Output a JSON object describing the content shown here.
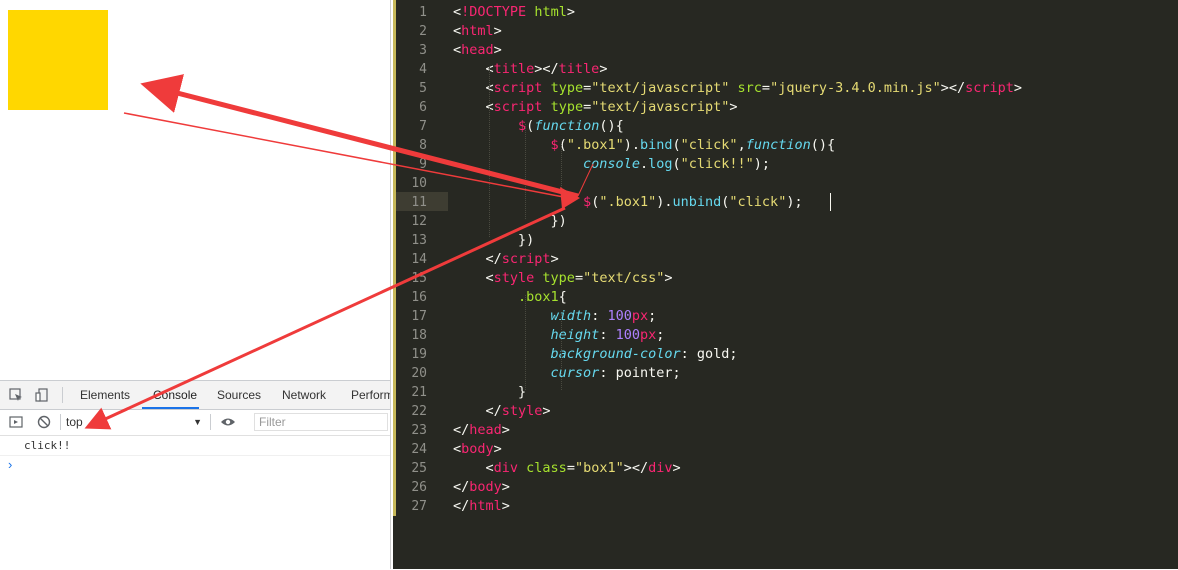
{
  "devtools": {
    "tabs": [
      {
        "label": "Elements"
      },
      {
        "label": "Console"
      },
      {
        "label": "Sources"
      },
      {
        "label": "Network"
      },
      {
        "label": "Perform"
      }
    ],
    "active_tab": "Console",
    "context": "top",
    "filter_placeholder": "Filter",
    "console_messages": [
      "click!!"
    ],
    "prompt_symbol": "›"
  },
  "editor": {
    "line_numbers": [
      "1",
      "2",
      "3",
      "4",
      "5",
      "6",
      "7",
      "8",
      "9",
      "10",
      "11",
      "12",
      "13",
      "14",
      "15",
      "16",
      "17",
      "18",
      "19",
      "20",
      "21",
      "22",
      "23",
      "24",
      "25",
      "26",
      "27"
    ],
    "active_line": 11,
    "lines": [
      [
        [
          "tk-plain",
          "<"
        ],
        [
          "tk-tag",
          "!DOCTYPE"
        ],
        [
          "tk-plain",
          " "
        ],
        [
          "tk-attr",
          "html"
        ],
        [
          "tk-plain",
          ">"
        ]
      ],
      [
        [
          "tk-plain",
          "<"
        ],
        [
          "tk-tag",
          "html"
        ],
        [
          "tk-plain",
          ">"
        ]
      ],
      [
        [
          "tk-plain",
          "<"
        ],
        [
          "tk-tag",
          "head"
        ],
        [
          "tk-plain",
          ">"
        ]
      ],
      [
        [
          "tk-plain",
          "    <"
        ],
        [
          "tk-tag",
          "title"
        ],
        [
          "tk-plain",
          "></"
        ],
        [
          "tk-tag",
          "title"
        ],
        [
          "tk-plain",
          ">"
        ]
      ],
      [
        [
          "tk-plain",
          "    <"
        ],
        [
          "tk-tag",
          "script"
        ],
        [
          "tk-plain",
          " "
        ],
        [
          "tk-attr",
          "type"
        ],
        [
          "tk-plain",
          "="
        ],
        [
          "tk-str",
          "\"text/javascript\""
        ],
        [
          "tk-plain",
          " "
        ],
        [
          "tk-attr",
          "src"
        ],
        [
          "tk-plain",
          "="
        ],
        [
          "tk-str",
          "\"jquery-3.4.0.min.js\""
        ],
        [
          "tk-plain",
          "></"
        ],
        [
          "tk-tag",
          "script"
        ],
        [
          "tk-plain",
          ">"
        ]
      ],
      [
        [
          "tk-plain",
          "    <"
        ],
        [
          "tk-tag",
          "script"
        ],
        [
          "tk-plain",
          " "
        ],
        [
          "tk-attr",
          "type"
        ],
        [
          "tk-plain",
          "="
        ],
        [
          "tk-str",
          "\"text/javascript\""
        ],
        [
          "tk-plain",
          ">"
        ]
      ],
      [
        [
          "tk-plain",
          "        "
        ],
        [
          "tk-dollar",
          "$"
        ],
        [
          "tk-plain",
          "("
        ],
        [
          "tk-kw",
          "function"
        ],
        [
          "tk-plain",
          "(){"
        ]
      ],
      [
        [
          "tk-plain",
          "            "
        ],
        [
          "tk-dollar",
          "$"
        ],
        [
          "tk-plain",
          "("
        ],
        [
          "tk-str",
          "\".box1\""
        ],
        [
          "tk-plain",
          ")."
        ],
        [
          "tk-fn",
          "bind"
        ],
        [
          "tk-plain",
          "("
        ],
        [
          "tk-str",
          "\"click\""
        ],
        [
          "tk-plain",
          ","
        ],
        [
          "tk-kw",
          "function"
        ],
        [
          "tk-plain",
          "(){"
        ]
      ],
      [
        [
          "tk-plain",
          "                "
        ],
        [
          "tk-prop",
          "console"
        ],
        [
          "tk-plain",
          "."
        ],
        [
          "tk-fn",
          "log"
        ],
        [
          "tk-plain",
          "("
        ],
        [
          "tk-str",
          "\"click!!\""
        ],
        [
          "tk-plain",
          ");"
        ]
      ],
      [
        [
          "tk-plain",
          ""
        ]
      ],
      [
        [
          "tk-plain",
          "                "
        ],
        [
          "tk-dollar",
          "$"
        ],
        [
          "tk-plain",
          "("
        ],
        [
          "tk-str",
          "\".box1\""
        ],
        [
          "tk-plain",
          ")."
        ],
        [
          "tk-fn",
          "unbind"
        ],
        [
          "tk-plain",
          "("
        ],
        [
          "tk-str",
          "\"click\""
        ],
        [
          "tk-plain",
          ");"
        ]
      ],
      [
        [
          "tk-plain",
          "            })"
        ]
      ],
      [
        [
          "tk-plain",
          "        })"
        ]
      ],
      [
        [
          "tk-plain",
          "    </"
        ],
        [
          "tk-tag",
          "script"
        ],
        [
          "tk-plain",
          ">"
        ]
      ],
      [
        [
          "tk-plain",
          "    <"
        ],
        [
          "tk-tag",
          "style"
        ],
        [
          "tk-plain",
          " "
        ],
        [
          "tk-attr",
          "type"
        ],
        [
          "tk-plain",
          "="
        ],
        [
          "tk-str",
          "\"text/css\""
        ],
        [
          "tk-plain",
          ">"
        ]
      ],
      [
        [
          "tk-plain",
          "        "
        ],
        [
          "tk-sel",
          ".box1"
        ],
        [
          "tk-plain",
          "{"
        ]
      ],
      [
        [
          "tk-plain",
          "            "
        ],
        [
          "tk-prop",
          "width"
        ],
        [
          "tk-plain",
          ": "
        ],
        [
          "tk-num",
          "100"
        ],
        [
          "tk-unit",
          "px"
        ],
        [
          "tk-plain",
          ";"
        ]
      ],
      [
        [
          "tk-plain",
          "            "
        ],
        [
          "tk-prop",
          "height"
        ],
        [
          "tk-plain",
          ": "
        ],
        [
          "tk-num",
          "100"
        ],
        [
          "tk-unit",
          "px"
        ],
        [
          "tk-plain",
          ";"
        ]
      ],
      [
        [
          "tk-plain",
          "            "
        ],
        [
          "tk-prop",
          "background-color"
        ],
        [
          "tk-plain",
          ": gold;"
        ]
      ],
      [
        [
          "tk-plain",
          "            "
        ],
        [
          "tk-prop",
          "cursor"
        ],
        [
          "tk-plain",
          ": pointer;"
        ]
      ],
      [
        [
          "tk-plain",
          "        }"
        ]
      ],
      [
        [
          "tk-plain",
          "    </"
        ],
        [
          "tk-tag",
          "style"
        ],
        [
          "tk-plain",
          ">"
        ]
      ],
      [
        [
          "tk-plain",
          "</"
        ],
        [
          "tk-tag",
          "head"
        ],
        [
          "tk-plain",
          ">"
        ]
      ],
      [
        [
          "tk-plain",
          "<"
        ],
        [
          "tk-tag",
          "body"
        ],
        [
          "tk-plain",
          ">"
        ]
      ],
      [
        [
          "tk-plain",
          "    <"
        ],
        [
          "tk-tag",
          "div"
        ],
        [
          "tk-plain",
          " "
        ],
        [
          "tk-attr",
          "class"
        ],
        [
          "tk-plain",
          "="
        ],
        [
          "tk-str",
          "\"box1\""
        ],
        [
          "tk-plain",
          "></"
        ],
        [
          "tk-tag",
          "div"
        ],
        [
          "tk-plain",
          ">"
        ]
      ],
      [
        [
          "tk-plain",
          "</"
        ],
        [
          "tk-tag",
          "body"
        ],
        [
          "tk-plain",
          ">"
        ]
      ],
      [
        [
          "tk-plain",
          "</"
        ],
        [
          "tk-tag",
          "html"
        ],
        [
          "tk-plain",
          ">"
        ]
      ]
    ]
  },
  "colors": {
    "editor_bg": "#272822",
    "gold_box": "#ffd700",
    "arrow": "#ef3b3b",
    "devtools_accent": "#1a73e8"
  }
}
